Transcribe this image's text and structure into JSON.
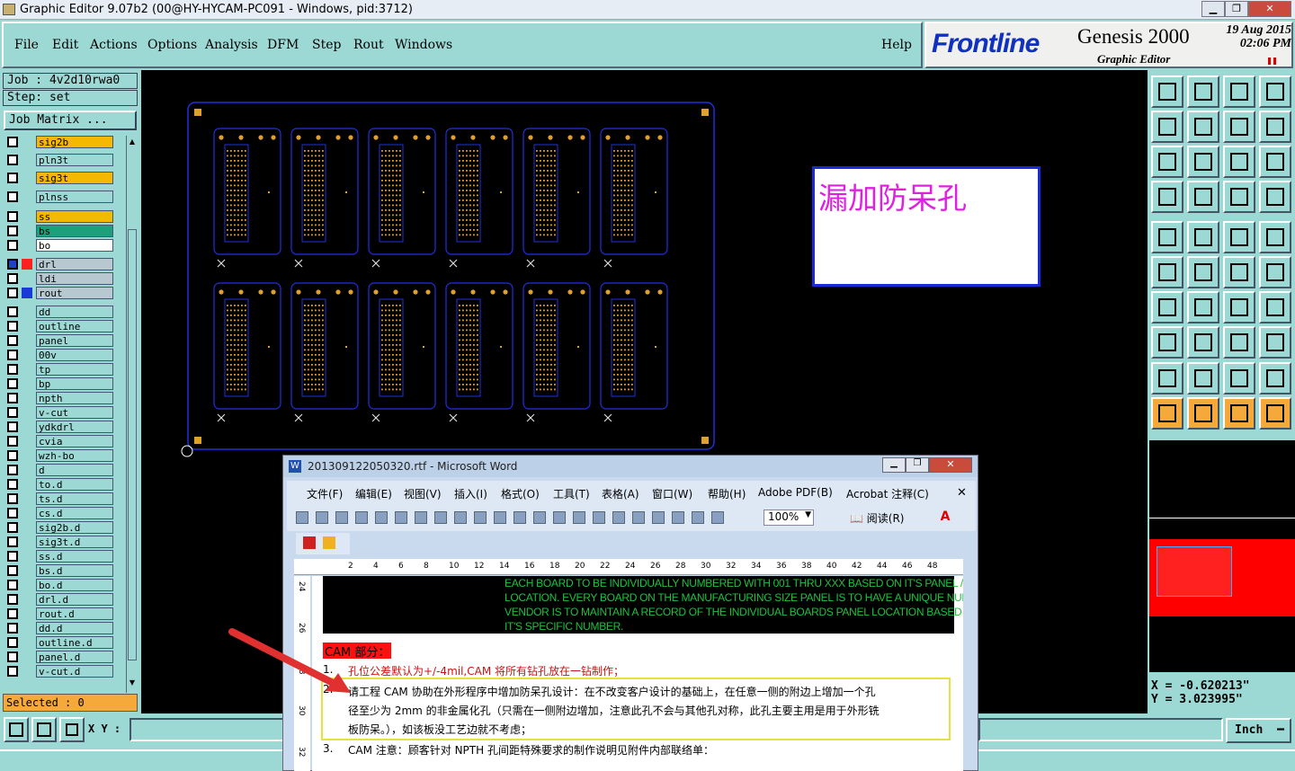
{
  "window": {
    "title": "Graphic Editor 9.07b2 (00@HY-HYCAM-PC091 - Windows, pid:3712)"
  },
  "menu": {
    "items": [
      "File",
      "Edit",
      "Actions",
      "Options",
      "Analysis",
      "DFM",
      "Step",
      "Rout",
      "Windows"
    ],
    "help": "Help"
  },
  "brand": {
    "logo": "Frontline",
    "product": "Genesis 2000",
    "subtitle": "Graphic Editor",
    "date": "19 Aug 2015",
    "time": "02:06 PM"
  },
  "job": {
    "job_line": "Job : 4v2d10rwa0",
    "step_line": "Step: set",
    "matrix_button": "Job Matrix ..."
  },
  "layers": [
    {
      "name": "sig2b",
      "bg": "#f5b800"
    },
    {
      "name": "pln3t",
      "bg": "#9cd9d5"
    },
    {
      "name": "sig3t",
      "bg": "#f5b800"
    },
    {
      "name": "plnss",
      "bg": "#9cd9d5"
    },
    {
      "name": "ss",
      "bg": "#f5b800"
    },
    {
      "name": "bs",
      "bg": "#1aa07a"
    },
    {
      "name": "bo",
      "bg": "#ffffff"
    },
    {
      "name": "drl",
      "bg": "#b8c8d0",
      "color": "#ff2020",
      "check": "#2040d0"
    },
    {
      "name": "ldi",
      "bg": "#b8c8d0"
    },
    {
      "name": "rout",
      "bg": "#b8c8d0",
      "color": "#1a3ad8"
    },
    {
      "name": "dd",
      "bg": "#9cd9d5"
    },
    {
      "name": "outline",
      "bg": "#9cd9d5"
    },
    {
      "name": "panel",
      "bg": "#9cd9d5"
    },
    {
      "name": "00v",
      "bg": "#9cd9d5"
    },
    {
      "name": "tp",
      "bg": "#9cd9d5"
    },
    {
      "name": "bp",
      "bg": "#9cd9d5"
    },
    {
      "name": "npth",
      "bg": "#9cd9d5"
    },
    {
      "name": "v-cut",
      "bg": "#9cd9d5"
    },
    {
      "name": "ydkdrl",
      "bg": "#9cd9d5"
    },
    {
      "name": "cvia",
      "bg": "#9cd9d5"
    },
    {
      "name": "wzh-bo",
      "bg": "#9cd9d5"
    },
    {
      "name": "d",
      "bg": "#9cd9d5"
    },
    {
      "name": "to.d",
      "bg": "#9cd9d5"
    },
    {
      "name": "ts.d",
      "bg": "#9cd9d5"
    },
    {
      "name": "cs.d",
      "bg": "#9cd9d5"
    },
    {
      "name": "sig2b.d",
      "bg": "#9cd9d5"
    },
    {
      "name": "sig3t.d",
      "bg": "#9cd9d5"
    },
    {
      "name": "ss.d",
      "bg": "#9cd9d5"
    },
    {
      "name": "bs.d",
      "bg": "#9cd9d5"
    },
    {
      "name": "bo.d",
      "bg": "#9cd9d5"
    },
    {
      "name": "drl.d",
      "bg": "#9cd9d5"
    },
    {
      "name": "rout.d",
      "bg": "#9cd9d5"
    },
    {
      "name": "dd.d",
      "bg": "#9cd9d5"
    },
    {
      "name": "outline.d",
      "bg": "#9cd9d5"
    },
    {
      "name": "panel.d",
      "bg": "#9cd9d5"
    },
    {
      "name": "v-cut.d",
      "bg": "#9cd9d5"
    }
  ],
  "status": {
    "selected": "Selected : 0",
    "xy_label": "X Y :",
    "units": "Inch",
    "x_readout": "X = -0.620213\"",
    "y_readout": "Y = 3.023995\""
  },
  "note": {
    "text": "漏加防呆孔"
  },
  "word": {
    "title": "201309122050320.rtf - Microsoft Word",
    "menus": [
      "文件(F)",
      "编辑(E)",
      "视图(V)",
      "插入(I)",
      "格式(O)",
      "工具(T)",
      "表格(A)",
      "窗口(W)",
      "帮助(H)",
      "Adobe PDF(B)",
      "Acrobat 注释(C)"
    ],
    "zoom": "100%",
    "read_button": "阅读(R)",
    "ruler": [
      "2",
      "4",
      "6",
      "8",
      "10",
      "12",
      "14",
      "16",
      "18",
      "20",
      "22",
      "24",
      "26",
      "28",
      "30",
      "32",
      "34",
      "36",
      "38",
      "40",
      "42",
      "44",
      "46",
      "48"
    ],
    "vruler": [
      "24",
      "26",
      "28",
      "30",
      "32"
    ],
    "green_text": [
      "EACH BOARD TO BE INDIVIDUALLY NUMBERED WITH 001 THRU XXX BASED ON IT'S PANEL / SUBPA",
      "LOCATION.  EVERY BOARD ON THE MANUFACTURING SIZE PANEL IS TO HAVE A UNIQUE NUMBER.",
      "VENDOR IS TO MAINTAIN A RECORD OF THE INDIVIDUAL BOARDS PANEL LOCATION BASED ON",
      "IT'S SPECIFIC NUMBER."
    ],
    "cam_heading": "CAM 部分：",
    "item1_num": "1.",
    "item1": "孔位公差默认为+/-4mil,CAM 将所有钻孔放在一钻制作；",
    "item2_num": "2.",
    "item2_lines": [
      "请工程 CAM 协助在外形程序中增加防呆孔设计：在不改变客户设计的基础上，在任意一侧的附边上增加一个孔",
      "径至少为 2mm 的非金属化孔（只需在一侧附边增加，注意此孔不会与其他孔对称，此孔主要主用是用于外形铣",
      "板防呆。），如该板没工艺边就不考虑；"
    ],
    "item3_num": "3.",
    "item3": "CAM 注意：顾客针对 NPTH 孔间距特殊要求的制作说明见附件内部联络单："
  },
  "colors": {
    "teal": "#9cd9d5",
    "orange": "#f5a93a",
    "pcb_outline": "#2030e0",
    "pad": "#e0a030",
    "panel_red": "#ff0000",
    "magenta": "#e020e0"
  }
}
